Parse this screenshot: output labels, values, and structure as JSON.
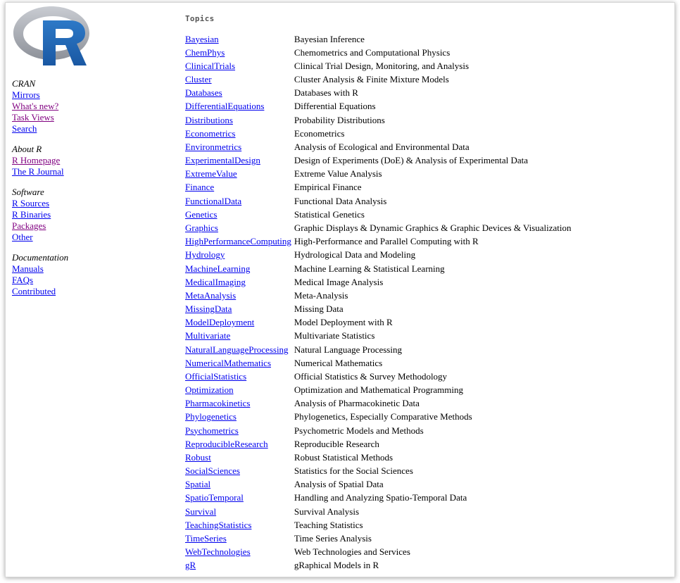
{
  "logo": {
    "letter": "R",
    "ring_color": "#9a9ea6",
    "letter_color": "#2166b5"
  },
  "sidebar": {
    "groups": [
      {
        "heading": "CRAN",
        "links": [
          {
            "label": "Mirrors",
            "visited": false
          },
          {
            "label": "What's new?",
            "visited": true
          },
          {
            "label": "Task Views",
            "visited": true
          },
          {
            "label": "Search",
            "visited": false
          }
        ]
      },
      {
        "heading": "About R",
        "links": [
          {
            "label": "R Homepage",
            "visited": true
          },
          {
            "label": "The R Journal",
            "visited": false
          }
        ]
      },
      {
        "heading": "Software",
        "links": [
          {
            "label": "R Sources",
            "visited": false
          },
          {
            "label": "R Binaries",
            "visited": false
          },
          {
            "label": "Packages",
            "visited": true
          },
          {
            "label": "Other",
            "visited": false
          }
        ]
      },
      {
        "heading": "Documentation",
        "links": [
          {
            "label": "Manuals",
            "visited": false
          },
          {
            "label": "FAQs",
            "visited": false
          },
          {
            "label": "Contributed",
            "visited": false
          }
        ]
      }
    ]
  },
  "main": {
    "heading": "Topics",
    "topics": [
      {
        "name": "Bayesian",
        "description": "Bayesian Inference"
      },
      {
        "name": "ChemPhys",
        "description": "Chemometrics and Computational Physics"
      },
      {
        "name": "ClinicalTrials",
        "description": "Clinical Trial Design, Monitoring, and Analysis"
      },
      {
        "name": "Cluster",
        "description": "Cluster Analysis & Finite Mixture Models"
      },
      {
        "name": "Databases",
        "description": "Databases with R"
      },
      {
        "name": "DifferentialEquations",
        "description": "Differential Equations"
      },
      {
        "name": "Distributions",
        "description": "Probability Distributions"
      },
      {
        "name": "Econometrics",
        "description": "Econometrics"
      },
      {
        "name": "Environmetrics",
        "description": "Analysis of Ecological and Environmental Data"
      },
      {
        "name": "ExperimentalDesign",
        "description": "Design of Experiments (DoE) & Analysis of Experimental Data"
      },
      {
        "name": "ExtremeValue",
        "description": "Extreme Value Analysis"
      },
      {
        "name": "Finance",
        "description": "Empirical Finance"
      },
      {
        "name": "FunctionalData",
        "description": "Functional Data Analysis"
      },
      {
        "name": "Genetics",
        "description": "Statistical Genetics"
      },
      {
        "name": "Graphics",
        "description": "Graphic Displays & Dynamic Graphics & Graphic Devices & Visualization"
      },
      {
        "name": "HighPerformanceComputing",
        "description": "High-Performance and Parallel Computing with R"
      },
      {
        "name": "Hydrology",
        "description": "Hydrological Data and Modeling"
      },
      {
        "name": "MachineLearning",
        "description": "Machine Learning & Statistical Learning"
      },
      {
        "name": "MedicalImaging",
        "description": "Medical Image Analysis"
      },
      {
        "name": "MetaAnalysis",
        "description": "Meta-Analysis"
      },
      {
        "name": "MissingData",
        "description": "Missing Data"
      },
      {
        "name": "ModelDeployment",
        "description": "Model Deployment with R"
      },
      {
        "name": "Multivariate",
        "description": "Multivariate Statistics"
      },
      {
        "name": "NaturalLanguageProcessing",
        "description": "Natural Language Processing"
      },
      {
        "name": "NumericalMathematics",
        "description": "Numerical Mathematics"
      },
      {
        "name": "OfficialStatistics",
        "description": "Official Statistics & Survey Methodology"
      },
      {
        "name": "Optimization",
        "description": "Optimization and Mathematical Programming"
      },
      {
        "name": "Pharmacokinetics",
        "description": "Analysis of Pharmacokinetic Data"
      },
      {
        "name": "Phylogenetics",
        "description": "Phylogenetics, Especially Comparative Methods"
      },
      {
        "name": "Psychometrics",
        "description": "Psychometric Models and Methods"
      },
      {
        "name": "ReproducibleResearch",
        "description": "Reproducible Research"
      },
      {
        "name": "Robust",
        "description": "Robust Statistical Methods"
      },
      {
        "name": "SocialSciences",
        "description": "Statistics for the Social Sciences"
      },
      {
        "name": "Spatial",
        "description": "Analysis of Spatial Data"
      },
      {
        "name": "SpatioTemporal",
        "description": "Handling and Analyzing Spatio-Temporal Data"
      },
      {
        "name": "Survival",
        "description": "Survival Analysis"
      },
      {
        "name": "TeachingStatistics",
        "description": "Teaching Statistics"
      },
      {
        "name": "TimeSeries",
        "description": "Time Series Analysis"
      },
      {
        "name": "WebTechnologies",
        "description": "Web Technologies and Services"
      },
      {
        "name": "gR",
        "description": "gRaphical Models in R"
      }
    ]
  },
  "colors": {
    "link": "#0000ee",
    "visited_link": "#800080",
    "heading_gray": "#555555"
  }
}
